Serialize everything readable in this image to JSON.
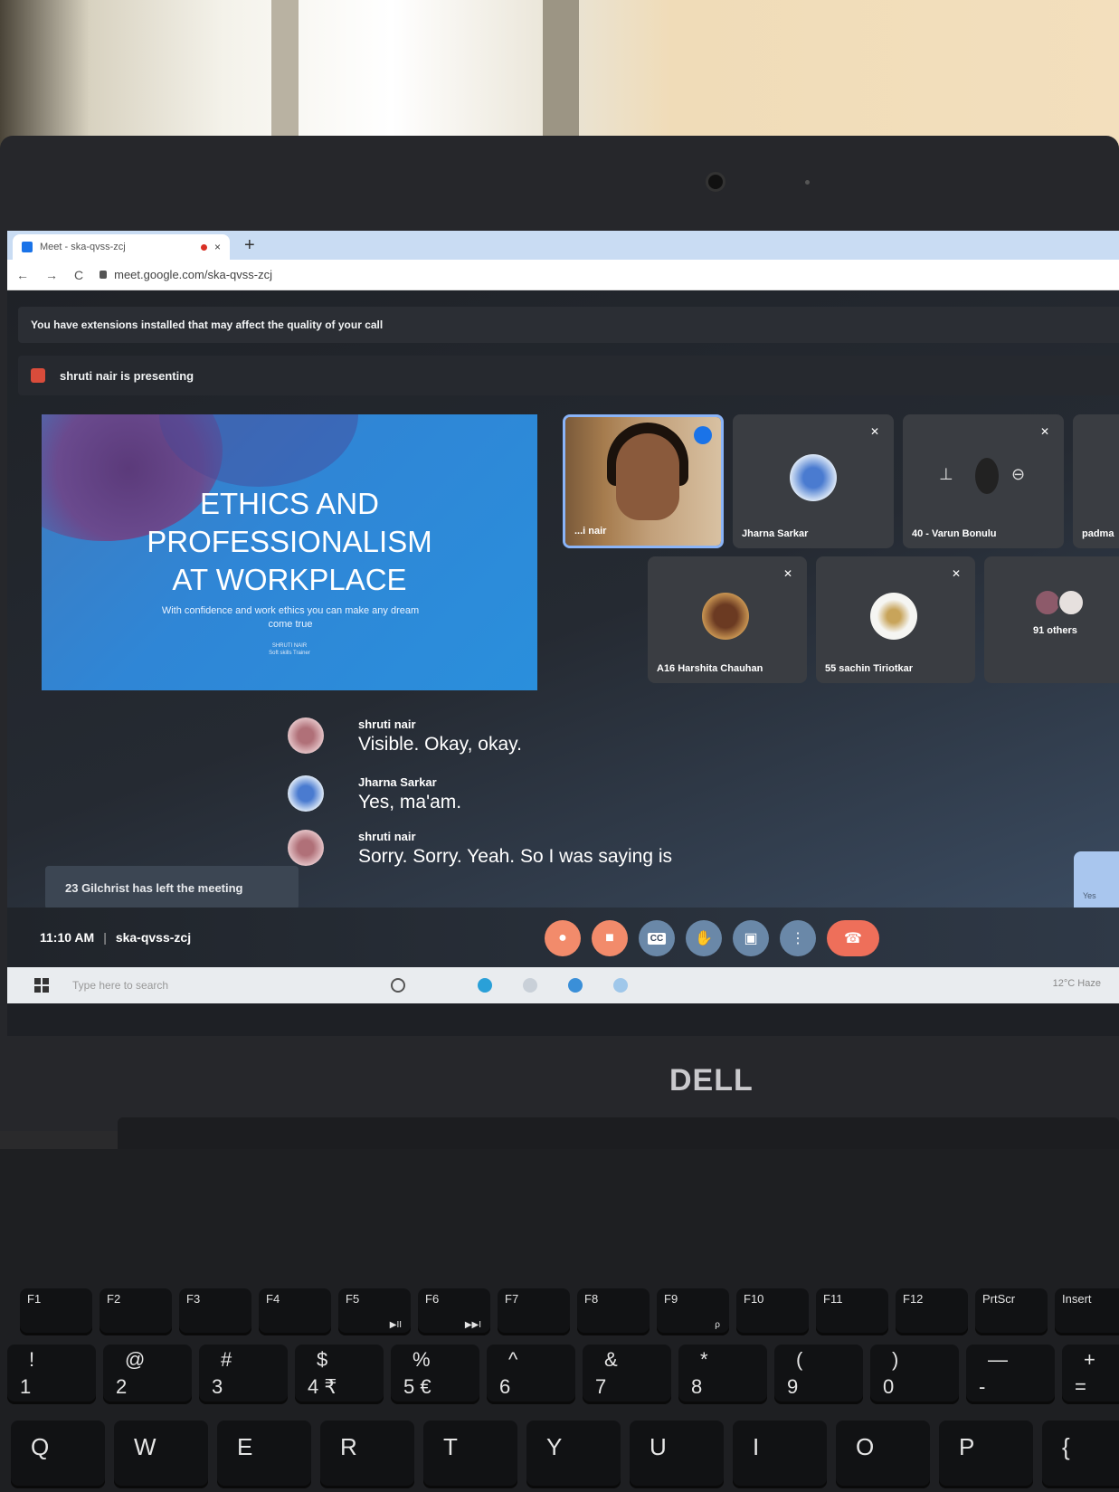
{
  "browser": {
    "tab_title": "Meet - ska-qvss-zcj",
    "close_glyph": "×",
    "new_tab_glyph": "+",
    "back_glyph": "←",
    "forward_glyph": "→",
    "reload_glyph": "C",
    "url": "meet.google.com/ska-qvss-zcj"
  },
  "meet": {
    "extension_warning": "You have extensions installed that may affect the quality of your call",
    "presenting_text": "shruti nair is presenting",
    "slide": {
      "title_line1": "ETHICS AND",
      "title_line2": "PROFESSIONALISM",
      "title_line3": "AT WORKPLACE",
      "subtitle": "With confidence and work ethics you can make any dream come true",
      "author_line1": "SHRUTI NAIR",
      "author_line2": "Soft skills Trainer"
    },
    "participants": [
      {
        "name": "...i nair",
        "active": true
      },
      {
        "name": "Jharna Sarkar",
        "muted": true
      },
      {
        "name": "40 - Varun Bonulu",
        "muted": true
      },
      {
        "name": "padma",
        "muted": false
      },
      {
        "name": "A16 Harshita Chauhan",
        "muted": true
      },
      {
        "name": "55 sachin Tiriotkar",
        "muted": true
      },
      {
        "name": "91 others"
      }
    ],
    "captions": [
      {
        "speaker": "shruti nair",
        "text": "Visible. Okay, okay."
      },
      {
        "speaker": "Jharna Sarkar",
        "text": "Yes, ma'am."
      },
      {
        "speaker": "shruti nair",
        "text": "Sorry. Sorry. Yeah. So I was saying is"
      }
    ],
    "toast": "23 Gilchrist has left the meeting",
    "side_chip_label": "Yes",
    "time": "11:10 AM",
    "meeting_code": "ska-qvss-zcj",
    "separator": "|",
    "controls": {
      "mic_icon": "mic-off-icon",
      "camera_icon": "camera-off-icon",
      "captions_icon": "cc-icon",
      "hand_icon": "raise-hand-icon",
      "present_icon": "present-icon",
      "more_icon": "more-icon",
      "end_icon": "end-call-icon",
      "cc_label": "CC"
    },
    "accent_colors": {
      "active_border": "#8ab4f8",
      "warn": "#f28b6b",
      "end_call": "#ee6f5a"
    }
  },
  "taskbar": {
    "search_placeholder": "Type here to search",
    "weather": "12°C Haze"
  },
  "laptop": {
    "brand": "DELL",
    "fn_keys": [
      {
        "label": "F1"
      },
      {
        "label": "F2"
      },
      {
        "label": "F3"
      },
      {
        "label": "F4"
      },
      {
        "label": "F5",
        "sub": "▶II"
      },
      {
        "label": "F6",
        "sub": "▶▶I"
      },
      {
        "label": "F7"
      },
      {
        "label": "F8"
      },
      {
        "label": "F9",
        "sub": "ρ"
      },
      {
        "label": "F10"
      },
      {
        "label": "F11"
      },
      {
        "label": "F12"
      },
      {
        "label": "PrtScr"
      },
      {
        "label": "Insert"
      }
    ],
    "num_keys": [
      {
        "top": "!",
        "bottom": "1"
      },
      {
        "top": "@",
        "bottom": "2"
      },
      {
        "top": "#",
        "bottom": "3"
      },
      {
        "top": "$",
        "bottom": "4 ₹"
      },
      {
        "top": "%",
        "bottom": "5 €"
      },
      {
        "top": "^",
        "bottom": "6"
      },
      {
        "top": "&",
        "bottom": "7"
      },
      {
        "top": "*",
        "bottom": "8"
      },
      {
        "top": "(",
        "bottom": "9"
      },
      {
        "top": ")",
        "bottom": "0"
      },
      {
        "top": "—",
        "bottom": "-"
      },
      {
        "top": "+",
        "bottom": "="
      }
    ],
    "letter_keys": [
      "Q",
      "W",
      "E",
      "R",
      "T",
      "Y",
      "U",
      "I",
      "O",
      "P",
      "{"
    ]
  }
}
